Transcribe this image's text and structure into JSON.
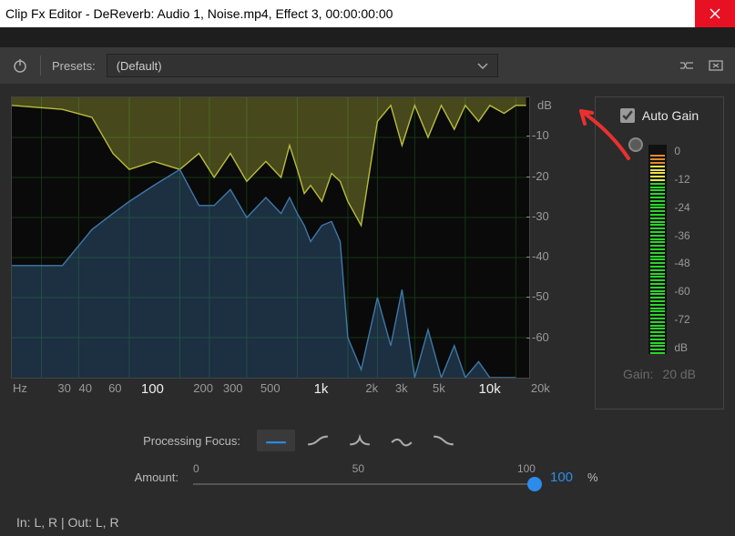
{
  "window": {
    "title": "Clip Fx Editor - DeReverb: Audio 1, Noise.mp4, Effect 3, 00:00:00:00"
  },
  "toolbar": {
    "presets_label": "Presets:",
    "preset_value": "(Default)"
  },
  "side": {
    "auto_gain_label": "Auto Gain",
    "auto_gain_checked": true,
    "gain_label": "Gain:",
    "gain_value": "20 dB",
    "scale": [
      "0",
      "-12",
      "-24",
      "-36",
      "-48",
      "-60",
      "-72",
      "dB"
    ]
  },
  "focus": {
    "label": "Processing Focus:",
    "icons": [
      "flat",
      "low-shelf",
      "bell-narrow",
      "bell-wide",
      "high-shelf"
    ],
    "active": 0
  },
  "amount": {
    "label": "Amount:",
    "ticks": [
      "0",
      "50",
      "100"
    ],
    "value": "100",
    "unit": "%"
  },
  "io": {
    "text": "In: L, R | Out: L, R"
  },
  "chart_data": {
    "type": "line",
    "xlabel": "Hz",
    "ylabel": "dB",
    "x_log": true,
    "xlim": [
      20,
      24000
    ],
    "ylim": [
      -70,
      0
    ],
    "x_ticks": [
      30,
      40,
      60,
      100,
      200,
      300,
      500,
      "1k",
      "2k",
      "3k",
      "5k",
      "10k",
      "20k"
    ],
    "x_tick_bold": [
      100,
      "1k",
      "10k"
    ],
    "y_ticks": [
      -10,
      -20,
      -30,
      -40,
      -50,
      -60
    ],
    "series": [
      {
        "name": "spectrum-yellow",
        "color": "#b9bd3e",
        "fill_to": 0,
        "x": [
          20,
          40,
          60,
          80,
          100,
          140,
          200,
          260,
          320,
          400,
          500,
          650,
          800,
          900,
          1000,
          1100,
          1200,
          1400,
          1600,
          1800,
          2000,
          2400,
          3000,
          3600,
          4200,
          5000,
          6000,
          7200,
          8600,
          10000,
          12000,
          14000,
          17000,
          20000,
          23000
        ],
        "y": [
          -2,
          -3,
          -5,
          -14,
          -18,
          -16,
          -18,
          -14,
          -20,
          -14,
          -21,
          -16,
          -20,
          -12,
          -18,
          -24,
          -22,
          -26,
          -19,
          -21,
          -26,
          -32,
          -6,
          -2,
          -12,
          -2,
          -10,
          -2,
          -8,
          -2,
          -6,
          -2,
          -4,
          -2,
          -2
        ]
      },
      {
        "name": "spectrum-blue",
        "color": "#3f78a8",
        "fill_to": -70,
        "x": [
          20,
          40,
          60,
          80,
          100,
          140,
          200,
          260,
          320,
          400,
          500,
          650,
          800,
          900,
          1000,
          1100,
          1200,
          1400,
          1600,
          1800,
          2000,
          2400,
          3000,
          3600,
          4200,
          5000,
          6000,
          7200,
          8600,
          10000,
          12000,
          14000,
          17000,
          20000
        ],
        "y": [
          -42,
          -42,
          -33,
          -29,
          -26,
          -22,
          -18,
          -27,
          -27,
          -23,
          -30,
          -25,
          -29,
          -25,
          -29,
          -32,
          -36,
          -32,
          -31,
          -36,
          -60,
          -68,
          -50,
          -62,
          -48,
          -70,
          -58,
          -70,
          -62,
          -70,
          -66,
          -70,
          -70,
          -70
        ]
      }
    ]
  }
}
